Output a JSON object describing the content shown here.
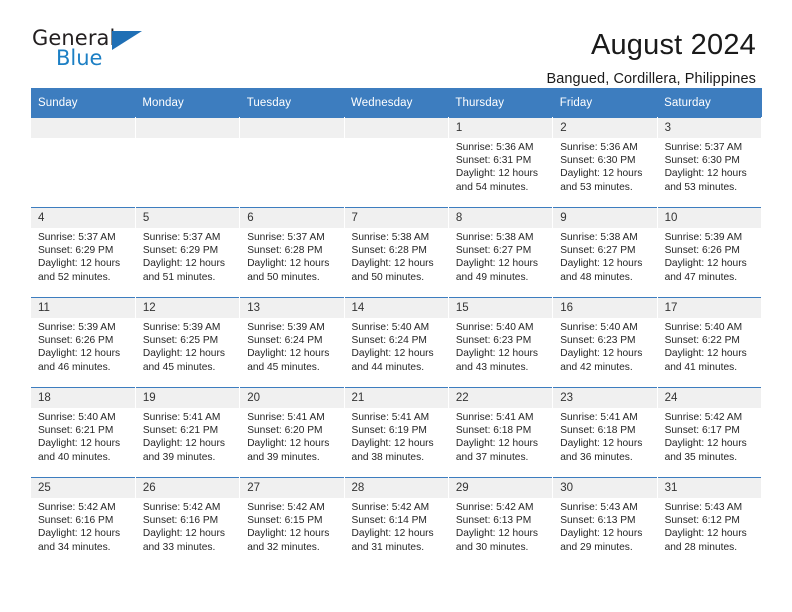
{
  "brand": {
    "name_top": "General",
    "name_bottom": "Blue",
    "triangle_color": "#1f6fb5",
    "blue_color": "#1c7fc4"
  },
  "header": {
    "title": "August 2024",
    "subtitle": "Bangued, Cordillera, Philippines",
    "accent_color": "#3d7dbf"
  },
  "weekdays": [
    "Sunday",
    "Monday",
    "Tuesday",
    "Wednesday",
    "Thursday",
    "Friday",
    "Saturday"
  ],
  "labels": {
    "sunrise": "Sunrise:",
    "sunset": "Sunset:",
    "daylight": "Daylight:"
  },
  "weeks": [
    [
      {
        "day": "",
        "empty": true
      },
      {
        "day": "",
        "empty": true
      },
      {
        "day": "",
        "empty": true
      },
      {
        "day": "",
        "empty": true
      },
      {
        "day": "1",
        "sunrise": "Sunrise: 5:36 AM",
        "sunset": "Sunset: 6:31 PM",
        "daylight1": "Daylight: 12 hours",
        "daylight2": "and 54 minutes."
      },
      {
        "day": "2",
        "sunrise": "Sunrise: 5:36 AM",
        "sunset": "Sunset: 6:30 PM",
        "daylight1": "Daylight: 12 hours",
        "daylight2": "and 53 minutes."
      },
      {
        "day": "3",
        "sunrise": "Sunrise: 5:37 AM",
        "sunset": "Sunset: 6:30 PM",
        "daylight1": "Daylight: 12 hours",
        "daylight2": "and 53 minutes."
      }
    ],
    [
      {
        "day": "4",
        "sunrise": "Sunrise: 5:37 AM",
        "sunset": "Sunset: 6:29 PM",
        "daylight1": "Daylight: 12 hours",
        "daylight2": "and 52 minutes."
      },
      {
        "day": "5",
        "sunrise": "Sunrise: 5:37 AM",
        "sunset": "Sunset: 6:29 PM",
        "daylight1": "Daylight: 12 hours",
        "daylight2": "and 51 minutes."
      },
      {
        "day": "6",
        "sunrise": "Sunrise: 5:37 AM",
        "sunset": "Sunset: 6:28 PM",
        "daylight1": "Daylight: 12 hours",
        "daylight2": "and 50 minutes."
      },
      {
        "day": "7",
        "sunrise": "Sunrise: 5:38 AM",
        "sunset": "Sunset: 6:28 PM",
        "daylight1": "Daylight: 12 hours",
        "daylight2": "and 50 minutes."
      },
      {
        "day": "8",
        "sunrise": "Sunrise: 5:38 AM",
        "sunset": "Sunset: 6:27 PM",
        "daylight1": "Daylight: 12 hours",
        "daylight2": "and 49 minutes."
      },
      {
        "day": "9",
        "sunrise": "Sunrise: 5:38 AM",
        "sunset": "Sunset: 6:27 PM",
        "daylight1": "Daylight: 12 hours",
        "daylight2": "and 48 minutes."
      },
      {
        "day": "10",
        "sunrise": "Sunrise: 5:39 AM",
        "sunset": "Sunset: 6:26 PM",
        "daylight1": "Daylight: 12 hours",
        "daylight2": "and 47 minutes."
      }
    ],
    [
      {
        "day": "11",
        "sunrise": "Sunrise: 5:39 AM",
        "sunset": "Sunset: 6:26 PM",
        "daylight1": "Daylight: 12 hours",
        "daylight2": "and 46 minutes."
      },
      {
        "day": "12",
        "sunrise": "Sunrise: 5:39 AM",
        "sunset": "Sunset: 6:25 PM",
        "daylight1": "Daylight: 12 hours",
        "daylight2": "and 45 minutes."
      },
      {
        "day": "13",
        "sunrise": "Sunrise: 5:39 AM",
        "sunset": "Sunset: 6:24 PM",
        "daylight1": "Daylight: 12 hours",
        "daylight2": "and 45 minutes."
      },
      {
        "day": "14",
        "sunrise": "Sunrise: 5:40 AM",
        "sunset": "Sunset: 6:24 PM",
        "daylight1": "Daylight: 12 hours",
        "daylight2": "and 44 minutes."
      },
      {
        "day": "15",
        "sunrise": "Sunrise: 5:40 AM",
        "sunset": "Sunset: 6:23 PM",
        "daylight1": "Daylight: 12 hours",
        "daylight2": "and 43 minutes."
      },
      {
        "day": "16",
        "sunrise": "Sunrise: 5:40 AM",
        "sunset": "Sunset: 6:23 PM",
        "daylight1": "Daylight: 12 hours",
        "daylight2": "and 42 minutes."
      },
      {
        "day": "17",
        "sunrise": "Sunrise: 5:40 AM",
        "sunset": "Sunset: 6:22 PM",
        "daylight1": "Daylight: 12 hours",
        "daylight2": "and 41 minutes."
      }
    ],
    [
      {
        "day": "18",
        "sunrise": "Sunrise: 5:40 AM",
        "sunset": "Sunset: 6:21 PM",
        "daylight1": "Daylight: 12 hours",
        "daylight2": "and 40 minutes."
      },
      {
        "day": "19",
        "sunrise": "Sunrise: 5:41 AM",
        "sunset": "Sunset: 6:21 PM",
        "daylight1": "Daylight: 12 hours",
        "daylight2": "and 39 minutes."
      },
      {
        "day": "20",
        "sunrise": "Sunrise: 5:41 AM",
        "sunset": "Sunset: 6:20 PM",
        "daylight1": "Daylight: 12 hours",
        "daylight2": "and 39 minutes."
      },
      {
        "day": "21",
        "sunrise": "Sunrise: 5:41 AM",
        "sunset": "Sunset: 6:19 PM",
        "daylight1": "Daylight: 12 hours",
        "daylight2": "and 38 minutes."
      },
      {
        "day": "22",
        "sunrise": "Sunrise: 5:41 AM",
        "sunset": "Sunset: 6:18 PM",
        "daylight1": "Daylight: 12 hours",
        "daylight2": "and 37 minutes."
      },
      {
        "day": "23",
        "sunrise": "Sunrise: 5:41 AM",
        "sunset": "Sunset: 6:18 PM",
        "daylight1": "Daylight: 12 hours",
        "daylight2": "and 36 minutes."
      },
      {
        "day": "24",
        "sunrise": "Sunrise: 5:42 AM",
        "sunset": "Sunset: 6:17 PM",
        "daylight1": "Daylight: 12 hours",
        "daylight2": "and 35 minutes."
      }
    ],
    [
      {
        "day": "25",
        "sunrise": "Sunrise: 5:42 AM",
        "sunset": "Sunset: 6:16 PM",
        "daylight1": "Daylight: 12 hours",
        "daylight2": "and 34 minutes."
      },
      {
        "day": "26",
        "sunrise": "Sunrise: 5:42 AM",
        "sunset": "Sunset: 6:16 PM",
        "daylight1": "Daylight: 12 hours",
        "daylight2": "and 33 minutes."
      },
      {
        "day": "27",
        "sunrise": "Sunrise: 5:42 AM",
        "sunset": "Sunset: 6:15 PM",
        "daylight1": "Daylight: 12 hours",
        "daylight2": "and 32 minutes."
      },
      {
        "day": "28",
        "sunrise": "Sunrise: 5:42 AM",
        "sunset": "Sunset: 6:14 PM",
        "daylight1": "Daylight: 12 hours",
        "daylight2": "and 31 minutes."
      },
      {
        "day": "29",
        "sunrise": "Sunrise: 5:42 AM",
        "sunset": "Sunset: 6:13 PM",
        "daylight1": "Daylight: 12 hours",
        "daylight2": "and 30 minutes."
      },
      {
        "day": "30",
        "sunrise": "Sunrise: 5:43 AM",
        "sunset": "Sunset: 6:13 PM",
        "daylight1": "Daylight: 12 hours",
        "daylight2": "and 29 minutes."
      },
      {
        "day": "31",
        "sunrise": "Sunrise: 5:43 AM",
        "sunset": "Sunset: 6:12 PM",
        "daylight1": "Daylight: 12 hours",
        "daylight2": "and 28 minutes."
      }
    ]
  ]
}
